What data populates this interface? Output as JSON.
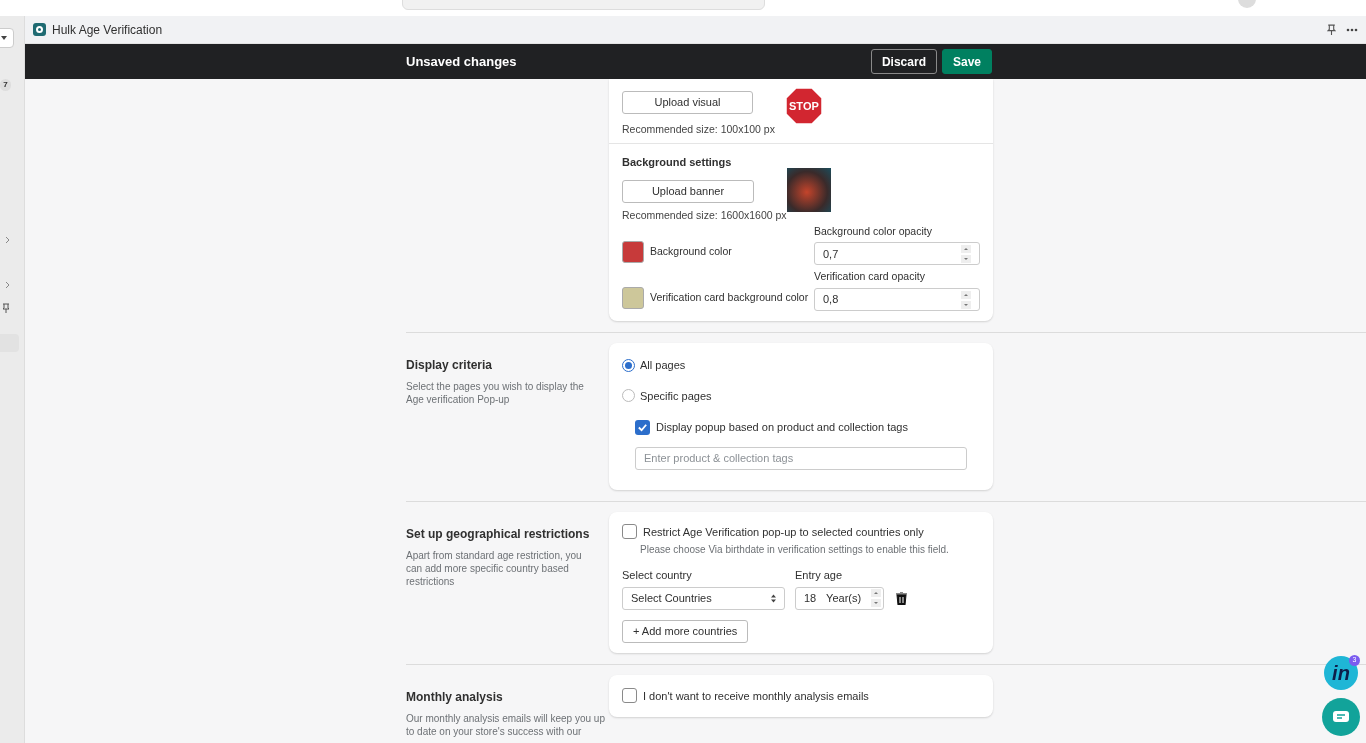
{
  "sidebar": {
    "badge": "7"
  },
  "app": {
    "title": "Hulk Age Verification"
  },
  "save_bar": {
    "message": "Unsaved changes",
    "buttons": [
      {
        "label": "Discard",
        "kind": "secondary"
      },
      {
        "label": "Save",
        "kind": "primary"
      }
    ]
  },
  "logo_settings": {
    "upload_label": "Upload visual",
    "hint": "Recommended size: 100x100 px",
    "preview": "STOP"
  },
  "background_settings": {
    "heading": "Background settings",
    "upload_label": "Upload banner",
    "hint": "Recommended size: 1600x1600 px",
    "colors": [
      {
        "label": "Background color",
        "color": "#c73a3a",
        "opacity_label": "Background color opacity",
        "opacity_value": "0,7"
      },
      {
        "label": "Verification card background color",
        "color": "#cdc79a",
        "opacity_label": "Verification card opacity",
        "opacity_value": "0,8"
      }
    ]
  },
  "display_criteria": {
    "title": "Display criteria",
    "description": "Select the pages you wish to display the Age verification Pop-up",
    "options": [
      {
        "label": "All pages",
        "selected": true
      },
      {
        "label": "Specific pages",
        "selected": false
      }
    ],
    "tags_checkbox": {
      "label": "Display popup based on product and collection tags",
      "checked": true
    },
    "tags_field": {
      "placeholder": "Enter product & collection tags"
    }
  },
  "geo_restrictions": {
    "title": "Set up geographical restrictions",
    "description": "Apart from standard age restriction, you can add more specific country based restrictions",
    "restrict_checkbox": {
      "label": "Restrict Age Verification pop-up to selected countries only",
      "checked": false
    },
    "help": "Please choose Via birthdate in verification settings to enable this field.",
    "country_label": "Select country",
    "country_value": "Select Countries",
    "age_label": "Entry age",
    "age_value": "18",
    "age_unit": "Year(s)",
    "add_button": "+ Add more countries"
  },
  "monthly_analysis": {
    "title": "Monthly analysis",
    "description": "Our monthly analysis emails will keep you up to date on your store's success with our",
    "opt_out": {
      "label": "I don't want to receive monthly analysis emails",
      "checked": false
    }
  },
  "widget": {
    "logo": "in",
    "badge": "3"
  }
}
